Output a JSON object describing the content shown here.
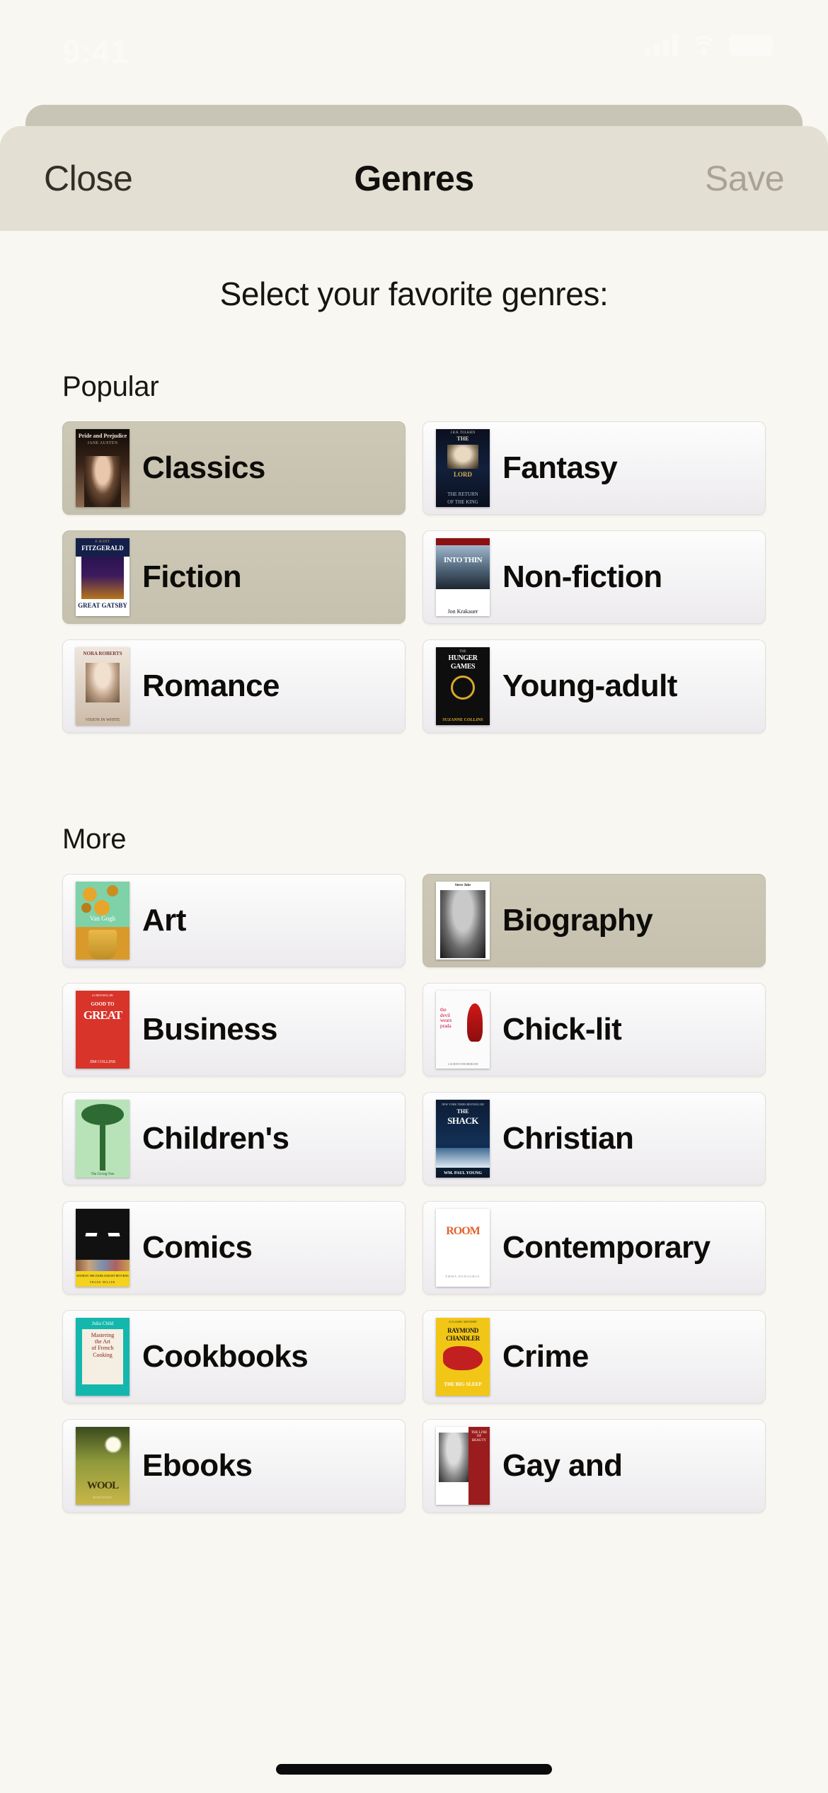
{
  "status_bar": {
    "time": "9:41",
    "icons": [
      "cellular-signal-icon",
      "wifi-icon",
      "battery-icon"
    ]
  },
  "navbar": {
    "close_label": "Close",
    "title": "Genres",
    "save_label": "Save"
  },
  "main": {
    "prompt": "Select your favorite genres:",
    "sections": [
      {
        "title": "Popular",
        "items": [
          {
            "label": "Classics",
            "selected": true,
            "cover": "cv-pride"
          },
          {
            "label": "Fantasy",
            "selected": false,
            "cover": "cv-lotr"
          },
          {
            "label": "Fiction",
            "selected": true,
            "cover": "cv-gatsby"
          },
          {
            "label": "Non-fiction",
            "selected": false,
            "cover": "cv-into"
          },
          {
            "label": "Romance",
            "selected": false,
            "cover": "cv-nora"
          },
          {
            "label": "Young-adult",
            "selected": false,
            "cover": "cv-hunger"
          }
        ]
      },
      {
        "title": "More",
        "items": [
          {
            "label": "Art",
            "selected": false,
            "cover": "cv-vangogh"
          },
          {
            "label": "Biography",
            "selected": true,
            "cover": "cv-jobs"
          },
          {
            "label": "Business",
            "selected": false,
            "cover": "cv-g2g"
          },
          {
            "label": "Chick-lit",
            "selected": false,
            "cover": "cv-prada"
          },
          {
            "label": "Children's",
            "selected": false,
            "cover": "cv-giving"
          },
          {
            "label": "Christian",
            "selected": false,
            "cover": "cv-shack"
          },
          {
            "label": "Comics",
            "selected": false,
            "cover": "cv-batman"
          },
          {
            "label": "Contemporary",
            "selected": false,
            "cover": "cv-room"
          },
          {
            "label": "Cookbooks",
            "selected": false,
            "cover": "cv-julia"
          },
          {
            "label": "Crime",
            "selected": false,
            "cover": "cv-chandler"
          },
          {
            "label": "Ebooks",
            "selected": false,
            "cover": "cv-wool"
          },
          {
            "label": "Gay and",
            "selected": false,
            "cover": "cv-gay"
          }
        ]
      }
    ]
  },
  "covers": {
    "cv-pride": {
      "title": "Pride and Prejudice",
      "author": "JANE AUSTEN"
    },
    "cv-lotr": {
      "top": "J.R.R. TOLKIEN",
      "series": "LORD",
      "l1": "THE RETURN",
      "l2": "OF THE KING"
    },
    "cv-gatsby": {
      "author": "F. SCOTT",
      "name": "FITZGERALD",
      "title": "GREAT GATSBY"
    },
    "cv-into": {
      "title": "INTO THIN",
      "author": "Jon Krakauer"
    },
    "cv-nora": {
      "author": "NORA ROBERTS",
      "title": "VISION IN WHITE"
    },
    "cv-hunger": {
      "top": "THE",
      "t1": "HUNGER",
      "t2": "GAMES",
      "author": "SUZANNE COLLINS"
    },
    "cv-vangogh": {
      "title": "Van Gogh"
    },
    "cv-jobs": {
      "title": "Steve Jobs"
    },
    "cv-g2g": {
      "badge": "#1 BESTSELLER",
      "t1": "GOOD TO",
      "t2": "GREAT",
      "author": "JIM COLLINS"
    },
    "cv-prada": {
      "title": "the devil wears prada",
      "author": "LAUREN WEISBERGER"
    },
    "cv-giving": {
      "title": "The Giving Tree"
    },
    "cv-shack": {
      "t1": "THE",
      "t2": "SHACK",
      "author": "WM. PAUL YOUNG"
    },
    "cv-batman": {
      "title": "BATMAN THE DARK KNIGHT RETURNS",
      "author": "FRANK MILLER"
    },
    "cv-room": {
      "title": "ROOM",
      "author": "EMMA DONOGHUE"
    },
    "cv-julia": {
      "author": "Julia Child",
      "title": "Mastering the Art of French Cooking"
    },
    "cv-chandler": {
      "t1": "RAYMOND",
      "t2": "CHANDLER",
      "title": "THE BIG SLEEP"
    },
    "cv-wool": {
      "title": "WOOL",
      "author": "HUGH HOWEY"
    },
    "cv-gay": {
      "title": "THE LINE OF BEAUTY"
    }
  },
  "colors": {
    "page_background": "#f8f7f2",
    "navbar_background": "#e3dfd3",
    "card_selected": "#cdc8b6",
    "card_unselected": "#fdfdfd",
    "title_text": "#100f0c",
    "save_disabled": "#a9a396"
  }
}
